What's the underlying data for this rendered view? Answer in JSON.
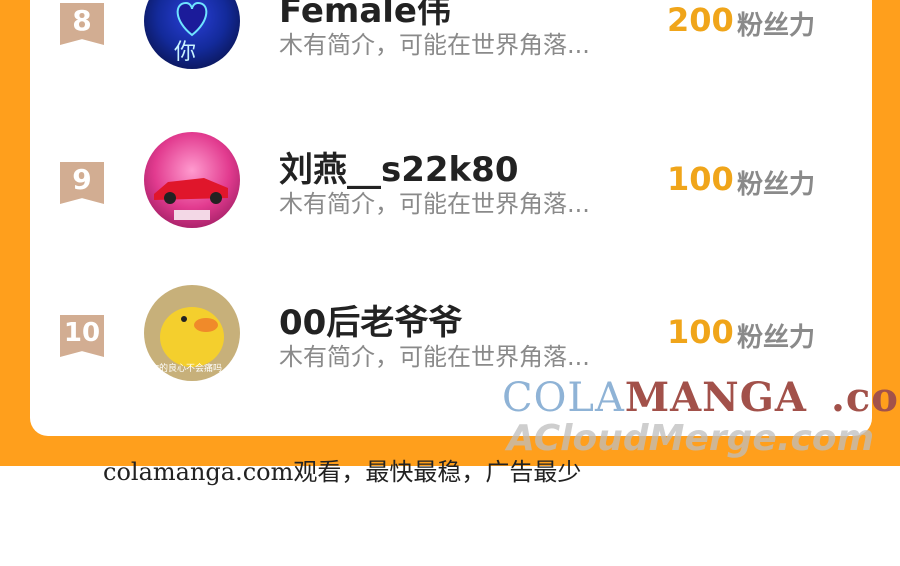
{
  "ranking": [
    {
      "rank": "8",
      "name": "Female伟",
      "desc": "木有简介，可能在世界角落...",
      "score": "200",
      "unit": "粉丝力",
      "avatar_text": "你"
    },
    {
      "rank": "9",
      "name": "刘燕__s22k80",
      "desc": "木有简介，可能在世界角落...",
      "score": "100",
      "unit": "粉丝力",
      "avatar_text": ""
    },
    {
      "rank": "10",
      "name": "00后老爷爷",
      "desc": "木有简介，可能在世界角落...",
      "score": "100",
      "unit": "粉丝力",
      "avatar_text": "你的良心不会痛吗"
    }
  ],
  "watermark": {
    "cola": "COLA",
    "manga": "MANGA",
    "com": ".com",
    "acloud": "ACloudMerge.com"
  },
  "footer_text": "colamanga.com观看，最快最稳，广告最少",
  "colors": {
    "orange": "#ff9f1c",
    "rank_badge": "#d2ad92",
    "score": "#f0a51a"
  }
}
